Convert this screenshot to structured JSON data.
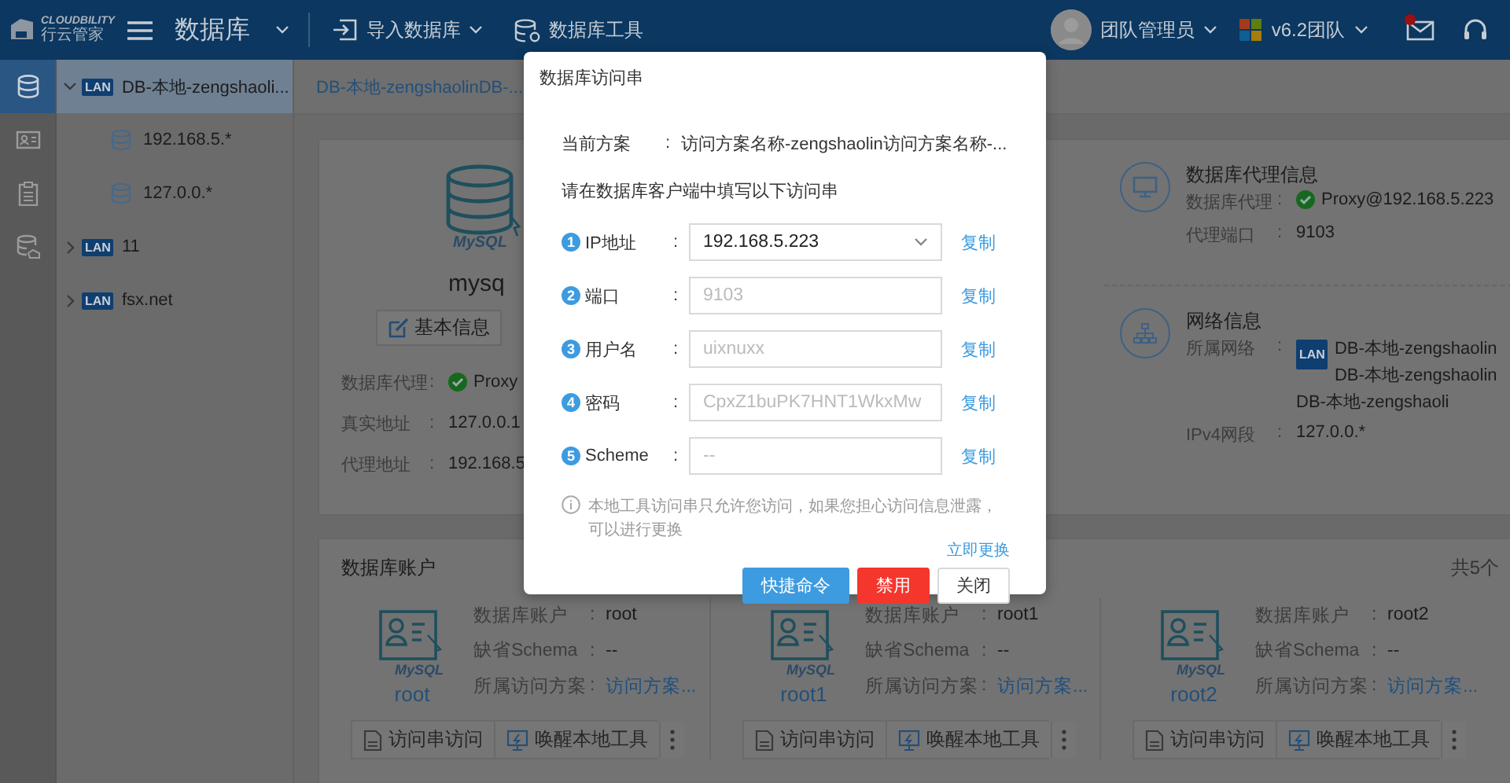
{
  "header": {
    "logo": {
      "name": "CLOUDBILITY",
      "tagline": "行云管家"
    },
    "app_title": "数据库",
    "actions": [
      {
        "label": "导入数据库",
        "kind": "dropdown"
      },
      {
        "label": "数据库工具",
        "kind": "button"
      }
    ],
    "user": "团队管理员",
    "team": "v6.2团队",
    "mail_unread": true
  },
  "rail": [
    {
      "selected": true
    },
    {
      "selected": false
    },
    {
      "selected": false
    },
    {
      "selected": false
    }
  ],
  "tree": [
    {
      "badge": "LAN",
      "label": "DB-本地-zengshaoli...",
      "expanded": true,
      "selected": true,
      "children": [
        {
          "label": "192.168.5.*",
          "selected": false
        },
        {
          "label": "127.0.0.*",
          "selected": false
        }
      ]
    },
    {
      "badge": "LAN",
      "label": "11",
      "expanded": false,
      "selected": false
    },
    {
      "badge": "LAN",
      "label": "fsx.net",
      "expanded": false,
      "selected": false
    }
  ],
  "breadcrumb_tab": "DB-本地-zengshaolinDB-...",
  "instance_card": {
    "icon_caption": "MySQL",
    "name": "mysq",
    "buttons": [
      "基本信息"
    ],
    "fields": [
      {
        "label": "数据库代理",
        "sep": ":",
        "value": "Proxy",
        "kind": "status"
      },
      {
        "label": "真实地址",
        "sep": ":",
        "value": "127.0.0.1",
        "kind": "text"
      },
      {
        "label": "代理地址",
        "sep": ":",
        "value": "192.168.5",
        "kind": "text"
      }
    ],
    "proxy_info": {
      "title": "数据库代理信息",
      "fields": [
        {
          "label": "数据库代理",
          "sep": ":",
          "value": "Proxy@192.168.5.223",
          "kind": "status"
        },
        {
          "label": "代理端口",
          "sep": ":",
          "value": "9103",
          "kind": "text"
        }
      ]
    },
    "network_info": {
      "title": "网络信息",
      "fields": [
        {
          "label": "所属网络",
          "sep": ":",
          "badge": "LAN",
          "value": "DB-本地-zengshaolinDB-本地-zengshaolinDB-本地-zengshaoli",
          "kind": "network"
        },
        {
          "label": "IPv4网段",
          "sep": ":",
          "value": "127.0.0.*",
          "kind": "text"
        }
      ]
    }
  },
  "accounts_card": {
    "title": "数据库账户",
    "count": "共5个",
    "accounts": [
      {
        "icon_caption": "MySQL",
        "name": "root",
        "fields": [
          {
            "label": "数据库账户",
            "sep": ":",
            "value": "root",
            "kind": "text"
          },
          {
            "label": "缺省Schema",
            "sep": ":",
            "value": "--",
            "kind": "text"
          },
          {
            "label": "所属访问方案",
            "sep": ":",
            "value": "访问方案...",
            "kind": "link"
          }
        ],
        "actions": [
          "访问串访问",
          "唤醒本地工具"
        ]
      },
      {
        "icon_caption": "MySQL",
        "name": "root1",
        "fields": [
          {
            "label": "数据库账户",
            "sep": ":",
            "value": "root1",
            "kind": "text"
          },
          {
            "label": "缺省Schema",
            "sep": ":",
            "value": "--",
            "kind": "text"
          },
          {
            "label": "所属访问方案",
            "sep": ":",
            "value": "访问方案...",
            "kind": "link"
          }
        ],
        "actions": [
          "访问串访问",
          "唤醒本地工具"
        ]
      },
      {
        "icon_caption": "MySQL",
        "name": "root2",
        "fields": [
          {
            "label": "数据库账户",
            "sep": ":",
            "value": "root2",
            "kind": "text"
          },
          {
            "label": "缺省Schema",
            "sep": ":",
            "value": "--",
            "kind": "text"
          },
          {
            "label": "所属访问方案",
            "sep": ":",
            "value": "访问方案...",
            "kind": "link"
          }
        ],
        "actions": [
          "访问串访问",
          "唤醒本地工具"
        ]
      }
    ]
  },
  "dialog": {
    "title": "数据库访问串",
    "plan_label": "当前方案",
    "plan_sep": ":",
    "plan_value": "访问方案名称-zengshaolin访问方案名称-...",
    "instruction": "请在数据库客户端中填写以下访问串",
    "fields": [
      {
        "number": "1",
        "label": "IP地址",
        "sep": ":",
        "kind": "select",
        "value": "192.168.5.223",
        "disabled": false,
        "copy": "复制"
      },
      {
        "number": "2",
        "label": "端口",
        "sep": ":",
        "kind": "text",
        "value": "9103",
        "disabled": true,
        "copy": "复制"
      },
      {
        "number": "3",
        "label": "用户名",
        "sep": ":",
        "kind": "text",
        "value": "uixnuxx",
        "disabled": true,
        "copy": "复制"
      },
      {
        "number": "4",
        "label": "密码",
        "sep": ":",
        "kind": "text",
        "value": "CpxZ1buPK7HNT1WkxMw",
        "disabled": true,
        "copy": "复制"
      },
      {
        "number": "5",
        "label": "Scheme",
        "sep": ":",
        "kind": "text",
        "value": "--",
        "disabled": true,
        "copy": "复制"
      }
    ],
    "note": "本地工具访问串只允许您访问，如果您担心访问信息泄露，可以进行更换",
    "note_link": "立即更换",
    "buttons": [
      {
        "label": "快捷命令",
        "kind": "primary"
      },
      {
        "label": "禁用",
        "kind": "danger"
      },
      {
        "label": "关闭",
        "kind": "default"
      }
    ]
  }
}
